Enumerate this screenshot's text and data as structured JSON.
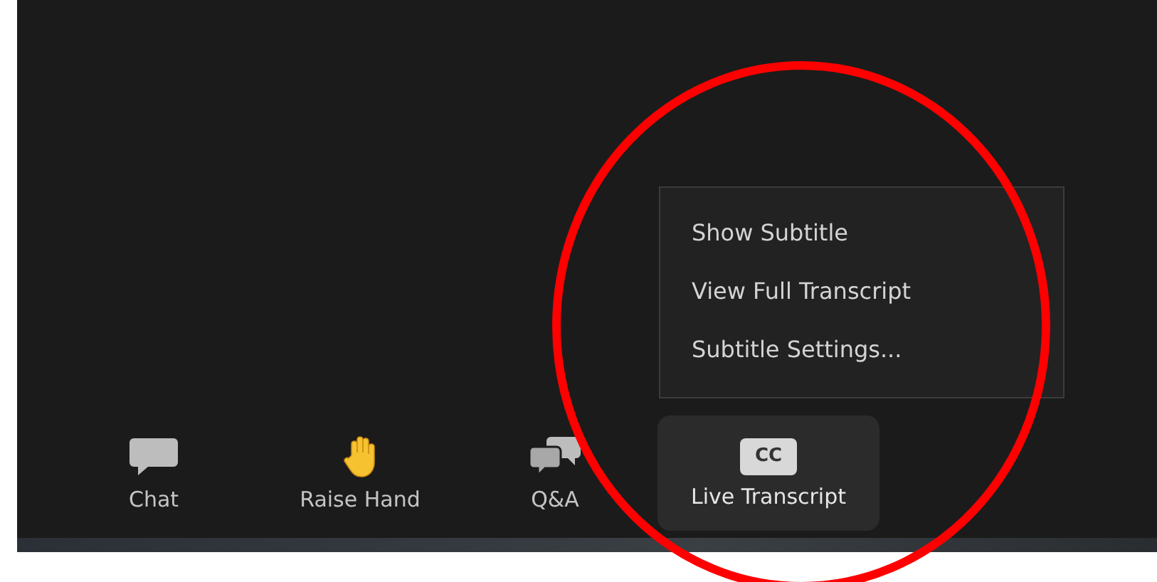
{
  "menu": {
    "items": [
      {
        "label": "Show Subtitle"
      },
      {
        "label": "View Full Transcript"
      },
      {
        "label": "Subtitle Settings..."
      }
    ]
  },
  "toolbar": {
    "buttons": [
      {
        "kind": "chat",
        "label": "Chat",
        "selected": false
      },
      {
        "kind": "hand",
        "label": "Raise Hand",
        "selected": false
      },
      {
        "kind": "qa",
        "label": "Q&A",
        "selected": false
      },
      {
        "kind": "cc",
        "label": "Live Transcript",
        "icon_text": "CC",
        "selected": true
      }
    ]
  }
}
